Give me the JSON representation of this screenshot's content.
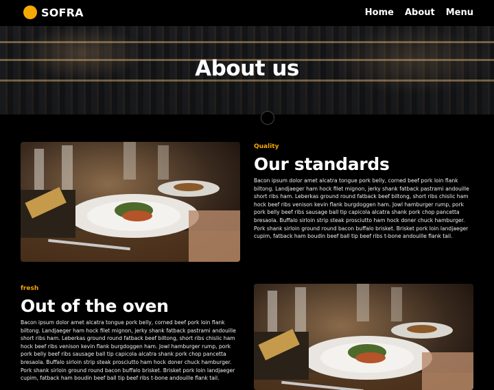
{
  "brand": {
    "name": "SOFRA",
    "logo_color": "#f5a905"
  },
  "nav": {
    "items": [
      "Home",
      "About",
      "Menu"
    ]
  },
  "hero": {
    "title": "About us"
  },
  "sections": [
    {
      "eyebrow": "Quality",
      "title": "Our standards",
      "text": "Bacon ipsum dolor amet alcatra tongue pork belly, corned beef pork loin flank biltong. Landjaeger ham hock filet mignon, jerky shank fatback pastrami andouille short ribs ham. Leberkas ground round fatback beef biltong, short ribs chislic ham hock beef ribs venison kevin flank burgdoggen ham. Jowl hamburger rump, pork pork belly beef ribs sausage ball tip capicola alcatra shank pork chop pancetta bresaola. Buffalo sirloin strip steak prosciutto ham hock doner chuck hamburger. Pork shank sirloin ground round bacon buffalo brisket. Brisket pork loin landjaeger cupim, fatback ham boudin beef ball tip beef ribs t-bone andouille flank tail."
    },
    {
      "eyebrow": "fresh",
      "title": "Out of the oven",
      "text": "Bacon ipsum dolor amet alcatra tongue pork belly, corned beef pork loin flank biltong. Landjaeger ham hock filet mignon, jerky shank fatback pastrami andouille short ribs ham. Leberkas ground round fatback beef biltong, short ribs chislic ham hock beef ribs venison kevin flank burgdoggen ham. Jowl hamburger rump, pork pork belly beef ribs sausage ball tip capicola alcatra shank pork chop pancetta bresaola. Buffalo sirloin strip steak prosciutto ham hock doner chuck hamburger. Pork shank sirloin ground round bacon buffalo brisket. Brisket pork loin landjaeger cupim, fatback ham boudin beef ball tip beef ribs t-bone andouille flank tail."
    }
  ],
  "colors": {
    "accent": "#f5a905",
    "background": "#000000",
    "text": "#ffffff"
  }
}
